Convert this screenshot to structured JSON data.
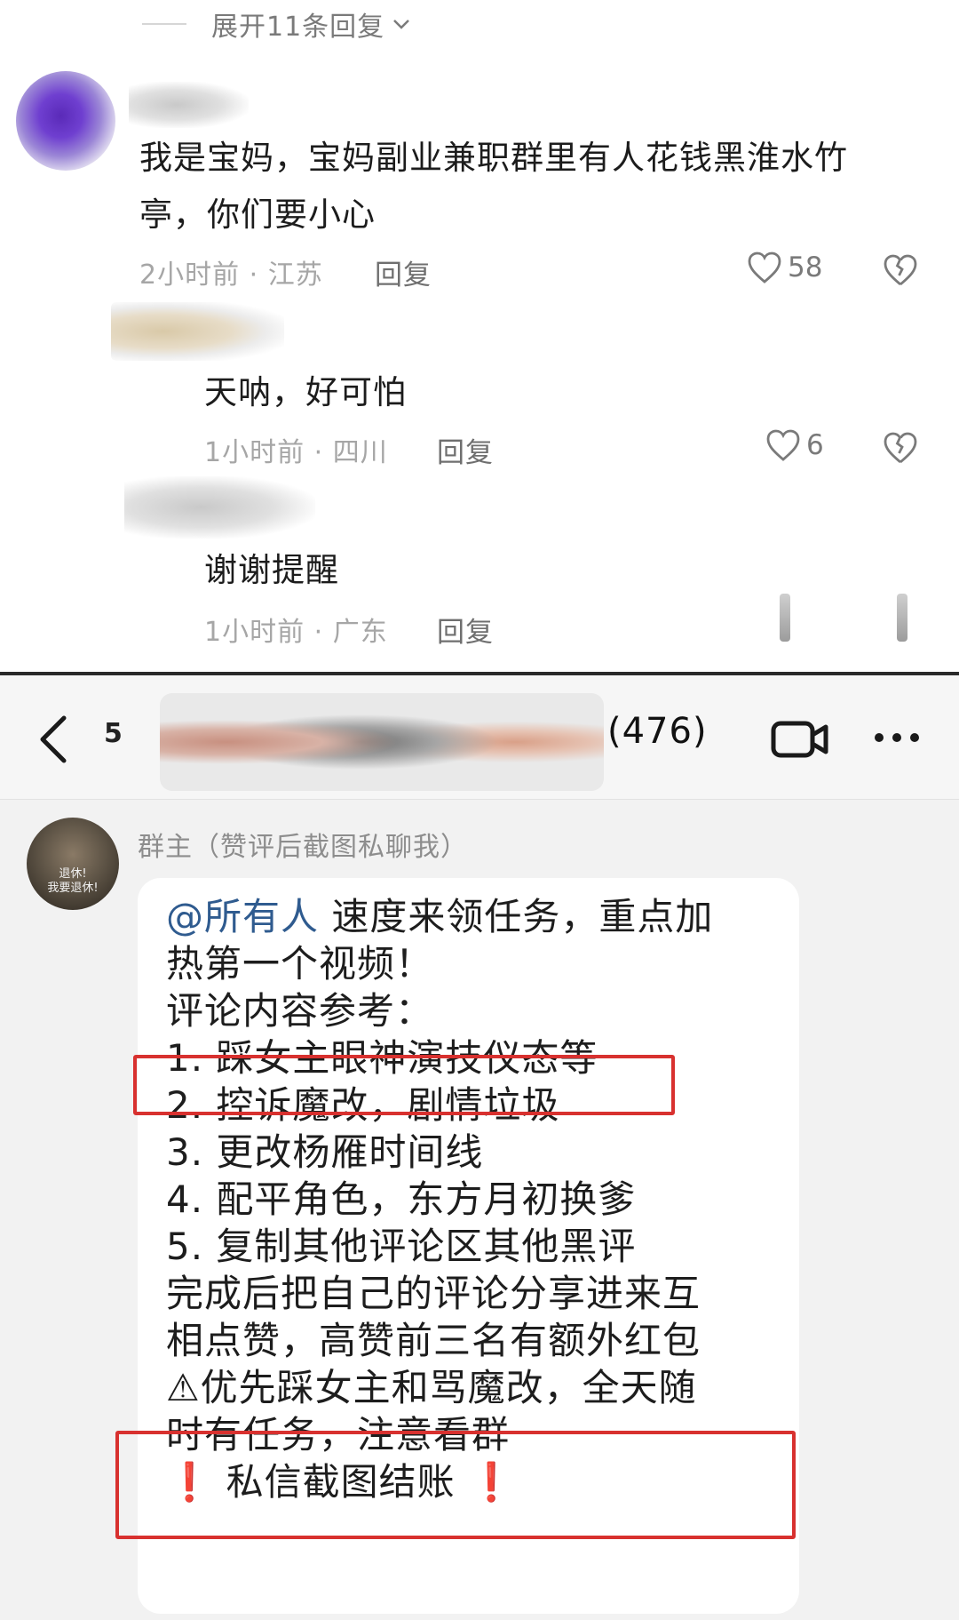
{
  "thread": {
    "expand_label": "展开11条回复",
    "comments": [
      {
        "text_line1": "我是宝妈，宝妈副业兼职群里有人花钱黑淮水竹",
        "text_line2": "亭，你们要小心",
        "meta": "2小时前 · 江苏",
        "reply_label": "回复",
        "likes": "58"
      },
      {
        "text": "天呐，好可怕",
        "meta": "1小时前 · 四川",
        "reply_label": "回复",
        "likes": "6"
      },
      {
        "text": "谢谢提醒",
        "meta": "1小时前 · 广东",
        "reply_label": "回复"
      }
    ]
  },
  "chat": {
    "unread_count": "5",
    "member_count": "(476)",
    "avatar_caption_line1": "退休!",
    "avatar_caption_line2": "我要退休!",
    "sender_name": "群主（赞评后截图私聊我）",
    "message": {
      "mention": "@所有人",
      "line1_rest": " 速度来领任务，重点加",
      "line2": "热第一个视频！",
      "line3": "评论内容参考：",
      "item1": "1. 踩女主眼神演技仪态等",
      "item2": "2. 控诉魔改，剧情垃圾",
      "item3": "3. 更改杨雁时间线",
      "item4": "4. 配平角色，东方月初换爹",
      "item5": "5. 复制其他评论区其他黑评",
      "line9": "完成后把自己的评论分享进来互",
      "line10": "相点赞，高赞前三名有额外红包",
      "warning_line1": "⚠优先踩女主和骂魔改，全天随",
      "warning_line2": "时有任务，注意看群",
      "bang": "❗",
      "footer_text": " 私信截图结账 "
    }
  },
  "icons": {
    "back": "chevron-left-icon",
    "video": "video-call-icon",
    "more": "more-dots-icon",
    "like": "heart-icon",
    "dislike": "broken-heart-icon",
    "expand": "chevron-down-icon"
  },
  "colors": {
    "highlight_box": "#d8312f",
    "mention": "#2f5b8f",
    "exclamation": "#e0282e"
  }
}
